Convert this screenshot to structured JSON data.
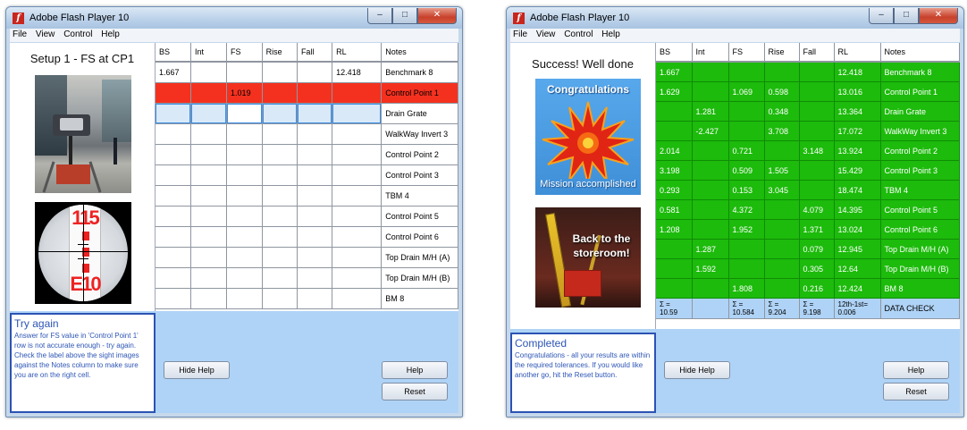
{
  "window_title": "Adobe Flash Player 10",
  "menu": [
    "File",
    "View",
    "Control",
    "Help"
  ],
  "columns": [
    "BS",
    "Int",
    "FS",
    "Rise",
    "Fall",
    "RL",
    "Notes"
  ],
  "left": {
    "setup_title": "Setup 1 - FS at CP1",
    "rows": [
      {
        "bs": "1.667",
        "int": "",
        "fs": "",
        "rise": "",
        "fall": "",
        "rl": "12.418",
        "notes": "Benchmark 8",
        "state": "normal"
      },
      {
        "bs": "",
        "int": "",
        "fs": "1.019",
        "rise": "",
        "fall": "",
        "rl": "",
        "notes": "Control Point 1",
        "state": "error"
      },
      {
        "bs": "",
        "int": "",
        "fs": "",
        "rise": "",
        "fall": "",
        "rl": "",
        "notes": "Drain Grate",
        "state": "selected"
      },
      {
        "bs": "",
        "int": "",
        "fs": "",
        "rise": "",
        "fall": "",
        "rl": "",
        "notes": "WalkWay Invert 3",
        "state": "normal"
      },
      {
        "bs": "",
        "int": "",
        "fs": "",
        "rise": "",
        "fall": "",
        "rl": "",
        "notes": "Control Point 2",
        "state": "normal"
      },
      {
        "bs": "",
        "int": "",
        "fs": "",
        "rise": "",
        "fall": "",
        "rl": "",
        "notes": "Control Point 3",
        "state": "normal"
      },
      {
        "bs": "",
        "int": "",
        "fs": "",
        "rise": "",
        "fall": "",
        "rl": "",
        "notes": "TBM 4",
        "state": "normal"
      },
      {
        "bs": "",
        "int": "",
        "fs": "",
        "rise": "",
        "fall": "",
        "rl": "",
        "notes": "Control Point 5",
        "state": "normal"
      },
      {
        "bs": "",
        "int": "",
        "fs": "",
        "rise": "",
        "fall": "",
        "rl": "",
        "notes": "Control Point 6",
        "state": "normal"
      },
      {
        "bs": "",
        "int": "",
        "fs": "",
        "rise": "",
        "fall": "",
        "rl": "",
        "notes": "Top Drain M/H (A)",
        "state": "normal"
      },
      {
        "bs": "",
        "int": "",
        "fs": "",
        "rise": "",
        "fall": "",
        "rl": "",
        "notes": "Top Drain M/H (B)",
        "state": "normal"
      },
      {
        "bs": "",
        "int": "",
        "fs": "",
        "rise": "",
        "fall": "",
        "rl": "",
        "notes": "BM 8",
        "state": "normal"
      }
    ],
    "help_title": "Try again",
    "help_text": "Answer for FS value in 'Control Point 1' row is not accurate enough - try again. Check the label above the sight images against the Notes column to make sure you are on the right cell.",
    "staff_reading_top": "115",
    "staff_reading_bottom": "E10",
    "hide_help": "Hide Help",
    "help": "Help",
    "reset": "Reset"
  },
  "right": {
    "title": "Success! Well done",
    "congrats": "Congratulations",
    "mission": "Mission accomplished",
    "back_line1": "Back to the",
    "back_line2": "storeroom!",
    "rows": [
      {
        "bs": "1.667",
        "int": "",
        "fs": "",
        "rise": "",
        "fall": "",
        "rl": "12.418",
        "notes": "Benchmark 8"
      },
      {
        "bs": "1.629",
        "int": "",
        "fs": "1.069",
        "rise": "0.598",
        "fall": "",
        "rl": "13.016",
        "notes": "Control Point 1"
      },
      {
        "bs": "",
        "int": "1.281",
        "fs": "",
        "rise": "0.348",
        "fall": "",
        "rl": "13.364",
        "notes": "Drain Grate"
      },
      {
        "bs": "",
        "int": "-2.427",
        "fs": "",
        "rise": "3.708",
        "fall": "",
        "rl": "17.072",
        "notes": "WalkWay Invert 3"
      },
      {
        "bs": "2.014",
        "int": "",
        "fs": "0.721",
        "rise": "",
        "fall": "3.148",
        "rl": "13.924",
        "notes": "Control Point 2"
      },
      {
        "bs": "3.198",
        "int": "",
        "fs": "0.509",
        "rise": "1.505",
        "fall": "",
        "rl": "15.429",
        "notes": "Control Point 3"
      },
      {
        "bs": "0.293",
        "int": "",
        "fs": "0.153",
        "rise": "3.045",
        "fall": "",
        "rl": "18.474",
        "notes": "TBM 4"
      },
      {
        "bs": "0.581",
        "int": "",
        "fs": "4.372",
        "rise": "",
        "fall": "4.079",
        "rl": "14.395",
        "notes": "Control Point 5"
      },
      {
        "bs": "1.208",
        "int": "",
        "fs": "1.952",
        "rise": "",
        "fall": "1.371",
        "rl": "13.024",
        "notes": "Control Point 6"
      },
      {
        "bs": "",
        "int": "1.287",
        "fs": "",
        "rise": "",
        "fall": "0.079",
        "rl": "12.945",
        "notes": "Top Drain M/H (A)"
      },
      {
        "bs": "",
        "int": "1.592",
        "fs": "",
        "rise": "",
        "fall": "0.305",
        "rl": "12.64",
        "notes": "Top Drain M/H (B)"
      },
      {
        "bs": "",
        "int": "",
        "fs": "1.808",
        "rise": "",
        "fall": "0.216",
        "rl": "12.424",
        "notes": "BM 8"
      }
    ],
    "sums": {
      "bs": [
        "Σ =",
        "10.59"
      ],
      "fs": [
        "Σ =",
        "10.584"
      ],
      "rise": [
        "Σ =",
        "9.204"
      ],
      "fall": [
        "Σ =",
        "9.198"
      ],
      "rl": [
        "12th-1st=",
        "0.006"
      ],
      "notes": "DATA CHECK"
    },
    "help_title": "Completed",
    "help_text": "Congratulations - all your results are within the required tolerances. If you would like another go, hit the Reset button.",
    "hide_help": "Hide Help",
    "help": "Help",
    "reset": "Reset"
  },
  "colors": {
    "error_red": "#f4311f",
    "success_green": "#1dbb0c",
    "bottom_blue": "#afd3f6",
    "help_blue": "#2d55b5"
  }
}
